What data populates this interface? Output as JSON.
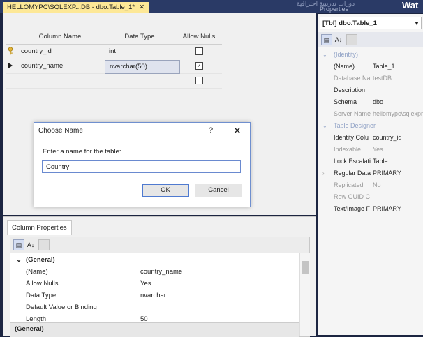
{
  "top": {
    "doc_tab": "HELLOMYPC\\SQLEXP...DB - dbo.Table_1*",
    "doc_tab_close": "✕",
    "overlay_text": "دورات تدريبية احترافية",
    "properties_tab": "Properties",
    "overlay_word": "Wat"
  },
  "table_grid": {
    "headers": {
      "name": "Column Name",
      "type": "Data Type",
      "nulls": "Allow Nulls"
    },
    "rows": [
      {
        "name": "country_id",
        "type": "int",
        "allow_nulls": false,
        "marker": "key"
      },
      {
        "name": "country_name",
        "type": "nvarchar(50)",
        "allow_nulls": true,
        "marker": "current"
      },
      {
        "name": "",
        "type": "",
        "allow_nulls": false,
        "marker": ""
      }
    ]
  },
  "dialog": {
    "title": "Choose Name",
    "help": "?",
    "close": "✕",
    "label": "Enter a name for the table:",
    "input_value": "Country",
    "ok": "OK",
    "cancel": "Cancel"
  },
  "column_properties": {
    "tab": "Column Properties",
    "section": "(General)",
    "rows": [
      {
        "key": "(Name)",
        "value": "country_name"
      },
      {
        "key": "Allow Nulls",
        "value": "Yes"
      },
      {
        "key": "Data Type",
        "value": "nvarchar"
      },
      {
        "key": "Default Value or Binding",
        "value": ""
      },
      {
        "key": "Length",
        "value": "50"
      }
    ],
    "bottom_section": "(General)"
  },
  "properties_panel": {
    "object": "[Tbl] dbo.Table_1",
    "identity_section": "(Identity)",
    "rows": [
      {
        "key": "(Name)",
        "value": "Table_1",
        "muted": false
      },
      {
        "key": "Database Na",
        "value": "testDB",
        "muted": true
      },
      {
        "key": "Description",
        "value": "",
        "muted": false
      },
      {
        "key": "Schema",
        "value": "dbo",
        "muted": false
      },
      {
        "key": "Server Name",
        "value": "hellomypc\\sqlexpr",
        "muted": true
      }
    ],
    "designer_section": "Table Designer",
    "designer_rows": [
      {
        "key": "Identity Colu",
        "value": "country_id",
        "muted": false
      },
      {
        "key": "Indexable",
        "value": "Yes",
        "muted": true
      },
      {
        "key": "Lock Escalati",
        "value": "Table",
        "muted": false
      },
      {
        "key": "Regular Data",
        "value": "PRIMARY",
        "muted": false
      },
      {
        "key": "Replicated",
        "value": "No",
        "muted": true
      },
      {
        "key": "Row GUID C",
        "value": "",
        "muted": true
      },
      {
        "key": "Text/Image F",
        "value": "PRIMARY",
        "muted": false
      }
    ]
  },
  "colors": {
    "doc_tab": "#fde897",
    "ide_background": "#1c2541",
    "focus_border": "#4f7ad0"
  }
}
